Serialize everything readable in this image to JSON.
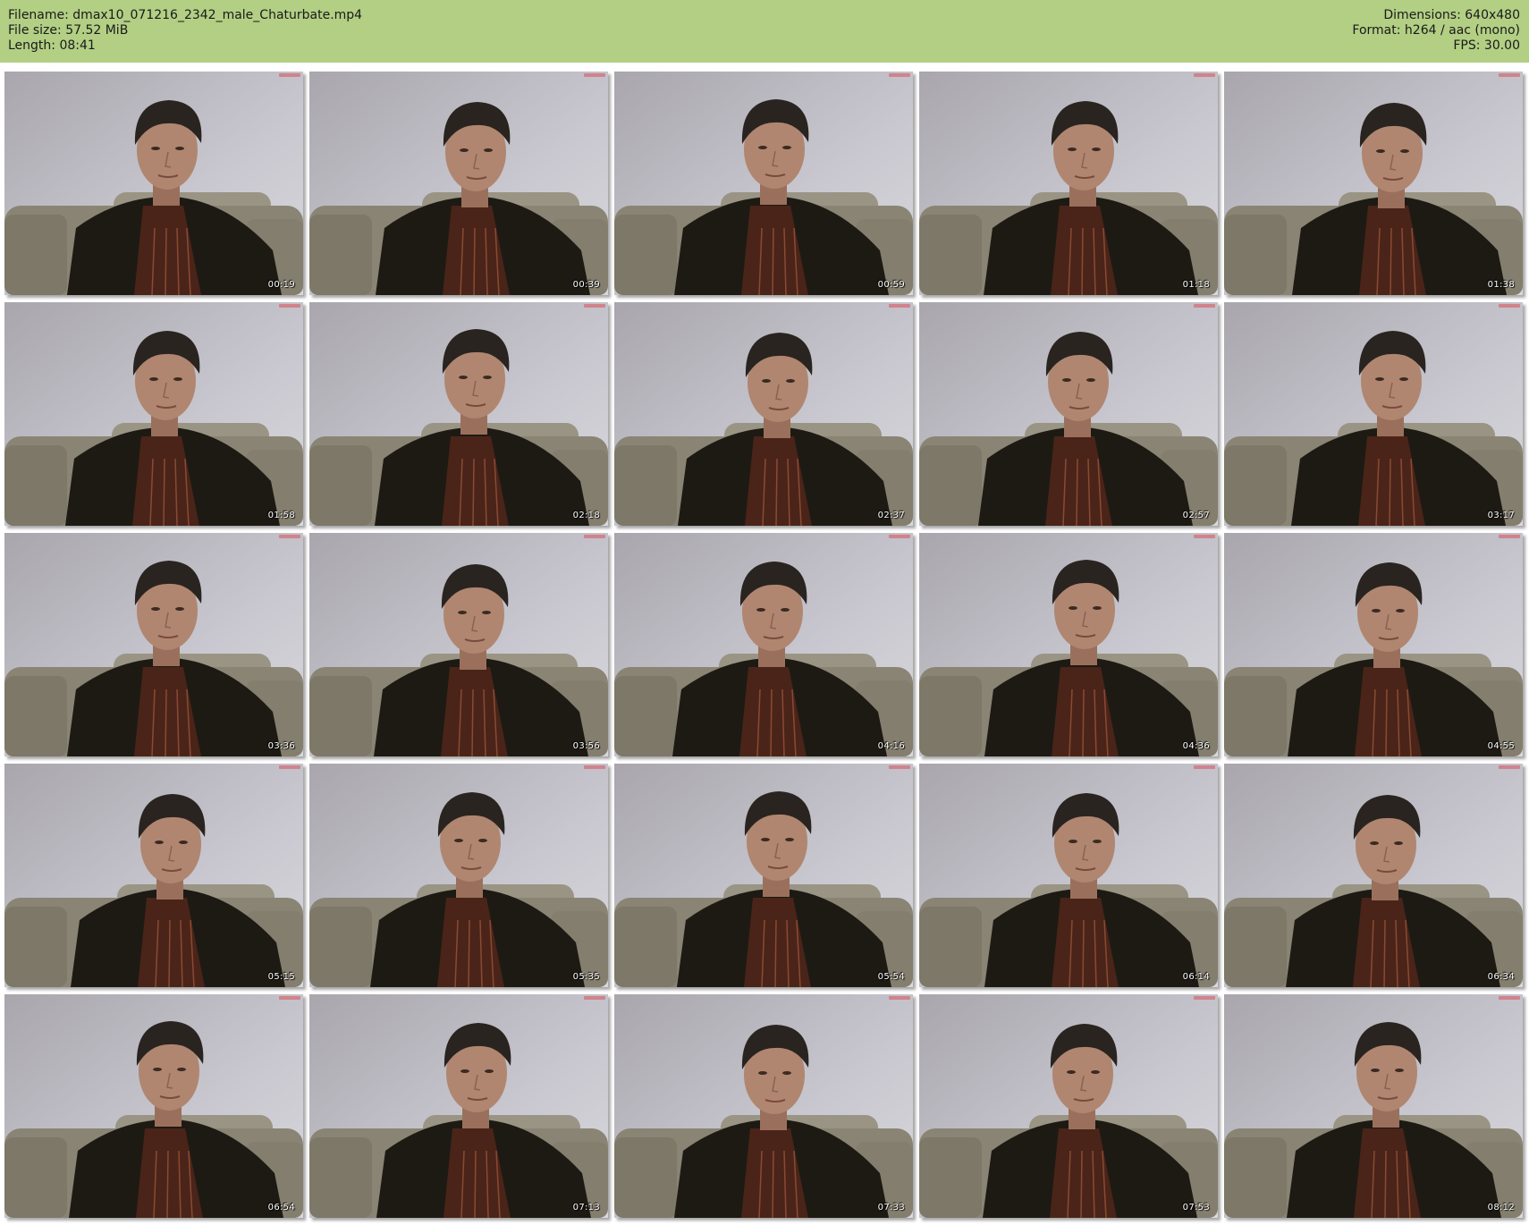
{
  "header": {
    "filename": "Filename: dmax10_071216_2342_male_Chaturbate.mp4",
    "filesize": "File size: 57.52 MiB",
    "length": "Length: 08:41",
    "dimensions": "Dimensions: 640x480",
    "format": "Format: h264 / aac (mono)",
    "fps": "FPS: 30.00"
  },
  "thumbnails": [
    {
      "timestamp": "00:19"
    },
    {
      "timestamp": "00:39"
    },
    {
      "timestamp": "00:59"
    },
    {
      "timestamp": "01:18"
    },
    {
      "timestamp": "01:38"
    },
    {
      "timestamp": "01:58"
    },
    {
      "timestamp": "02:18"
    },
    {
      "timestamp": "02:37"
    },
    {
      "timestamp": "02:57"
    },
    {
      "timestamp": "03:17"
    },
    {
      "timestamp": "03:36"
    },
    {
      "timestamp": "03:56"
    },
    {
      "timestamp": "04:16"
    },
    {
      "timestamp": "04:36"
    },
    {
      "timestamp": "04:55"
    },
    {
      "timestamp": "05:15"
    },
    {
      "timestamp": "05:35"
    },
    {
      "timestamp": "05:54"
    },
    {
      "timestamp": "06:14"
    },
    {
      "timestamp": "06:34"
    },
    {
      "timestamp": "06:54"
    },
    {
      "timestamp": "07:13"
    },
    {
      "timestamp": "07:33"
    },
    {
      "timestamp": "07:53"
    },
    {
      "timestamp": "08:12"
    }
  ],
  "colors": {
    "header_bg": "#b2cf84",
    "wall": "#c9c8d0",
    "sofa": "#8a8474",
    "jacket": "#1d1a14",
    "shirt": "#4a2418",
    "hair": "#2a2420",
    "skin": "#b08670"
  }
}
